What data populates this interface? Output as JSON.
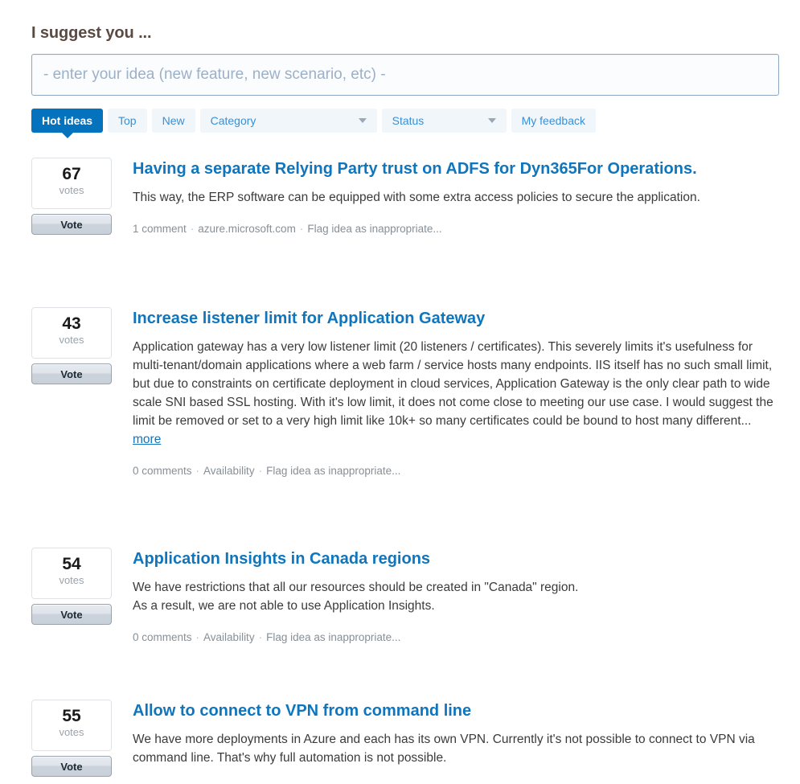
{
  "header": {
    "heading": "I suggest you ..."
  },
  "idea_input": {
    "placeholder": "- enter your idea (new feature, new scenario, etc) -",
    "value": ""
  },
  "filter_bar": {
    "tabs": [
      {
        "label": "Hot ideas",
        "active": true,
        "type": "tab"
      },
      {
        "label": "Top",
        "active": false,
        "type": "tab"
      },
      {
        "label": "New",
        "active": false,
        "type": "tab"
      },
      {
        "label": "Category",
        "active": false,
        "type": "dropdown"
      },
      {
        "label": "Status",
        "active": false,
        "type": "dropdown"
      },
      {
        "label": "My feedback",
        "active": false,
        "type": "tab"
      }
    ]
  },
  "vote_button_label": "Vote",
  "votes_label": "votes",
  "ideas": [
    {
      "votes": "67",
      "title": "Having a separate Relying Party trust on ADFS for Dyn365For Operations.",
      "description": "This way, the ERP software can be equipped with some extra access policies to secure the application.",
      "more_label": "",
      "comments": "1 comment",
      "category": "azure.microsoft.com",
      "flag": "Flag idea as inappropriate..."
    },
    {
      "votes": "43",
      "title": "Increase listener limit for Application Gateway",
      "description": "Application gateway has a very low listener limit (20 listeners / certificates). This severely limits it's usefulness for multi-tenant/domain applications where a web farm / service hosts many endpoints. IIS itself has no such small limit, but due to constraints on certificate deployment in cloud services, Application Gateway is the only clear path to wide scale SNI based SSL hosting. With it's low limit, it does not come close to meeting our use case. I would suggest the limit be removed or set to a very high limit like 10k+ so many certificates could be bound to host many different...",
      "more_label": "more",
      "comments": "0 comments",
      "category": "Availability",
      "flag": "Flag idea as inappropriate..."
    },
    {
      "votes": "54",
      "title": "Application Insights in Canada regions",
      "description": "We have restrictions that all our resources should be created in \"Canada\" region.\nAs a result, we are not able to use Application Insights.",
      "more_label": "",
      "comments": "0 comments",
      "category": "Availability",
      "flag": "Flag idea as inappropriate..."
    },
    {
      "votes": "55",
      "title": "Allow to connect to VPN from command line",
      "description": "We have more deployments in Azure and each has its own VPN. Currently it's not possible to connect to VPN via command line. That's why full automation is not possible.",
      "more_label": "",
      "comments": "",
      "category": "",
      "flag": ""
    }
  ],
  "colors": {
    "accent_blue": "#0572bd",
    "title_blue": "#0f75bd",
    "tab_bg": "#f1f6fb",
    "meta_gray": "#878f96",
    "heading_brown": "#5a4a42"
  }
}
